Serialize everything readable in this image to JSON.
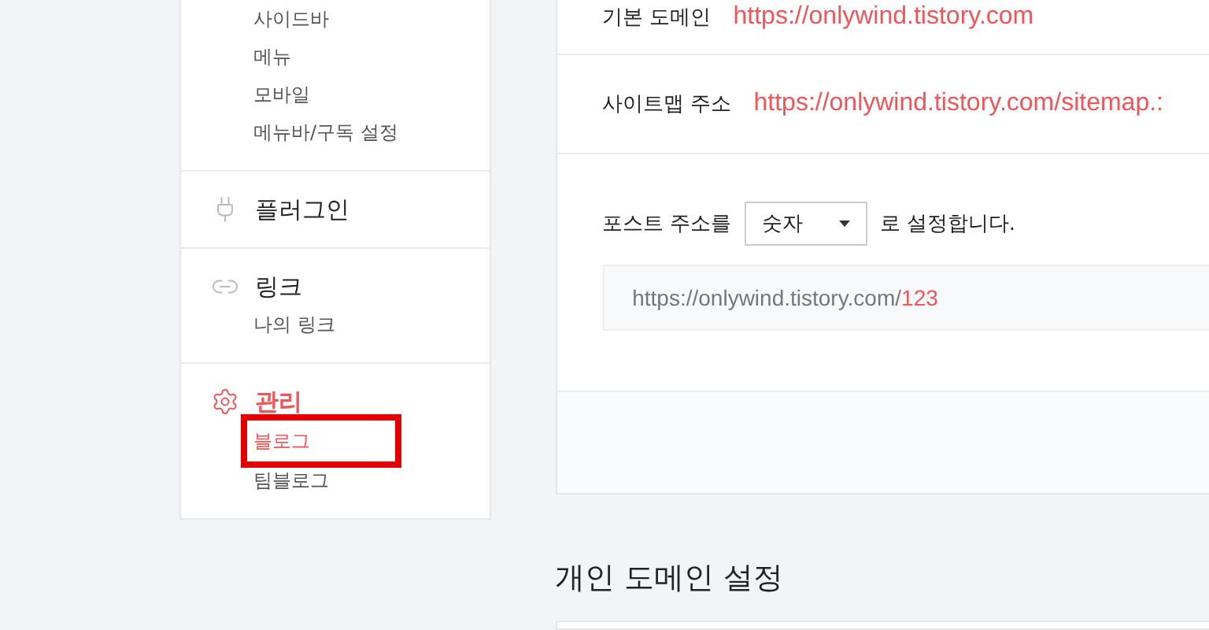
{
  "sidebar": {
    "groups": [
      {
        "kind": "plain",
        "children": [
          {
            "label": "사이드바",
            "selected": false,
            "highlighted": false
          },
          {
            "label": "메뉴",
            "selected": false,
            "highlighted": false
          },
          {
            "label": "모바일",
            "selected": false,
            "highlighted": false
          },
          {
            "label": "메뉴바/구독 설정",
            "selected": false,
            "highlighted": false
          }
        ]
      },
      {
        "kind": "plugin",
        "label": "플러그인",
        "active": false
      },
      {
        "kind": "link",
        "label": "링크",
        "active": false,
        "children": [
          {
            "label": "나의 링크",
            "selected": false,
            "highlighted": false
          }
        ]
      },
      {
        "kind": "manage",
        "label": "관리",
        "active": true,
        "children": [
          {
            "label": "블로그",
            "selected": true,
            "highlighted": true
          },
          {
            "label": "팀블로그",
            "selected": false,
            "highlighted": false
          }
        ]
      }
    ]
  },
  "address_panel": {
    "rows": [
      {
        "label": "기본 도메인",
        "url": "https://onlywind.tistory.com"
      },
      {
        "label": "사이트맵 주소",
        "url": "https://onlywind.tistory.com/sitemap.:"
      }
    ],
    "post_address": {
      "prefix": "포스트 주소를",
      "select_value": "숫자",
      "suffix": "로 설정합니다.",
      "preview_base": "https://onlywind.tistory.com/",
      "preview_tail": "123"
    }
  },
  "section_title": "개인 도메인 설정"
}
